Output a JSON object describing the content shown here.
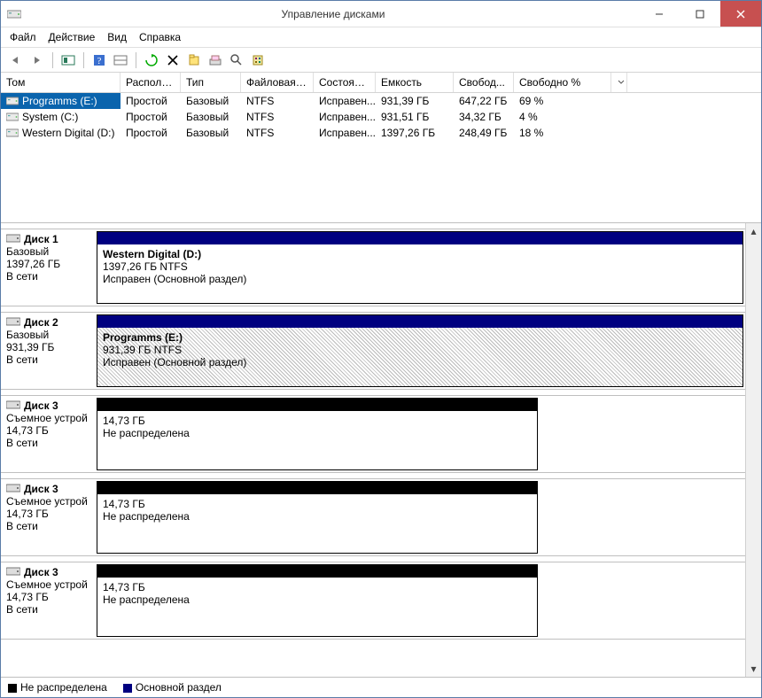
{
  "window": {
    "title": "Управление дисками"
  },
  "menu": {
    "file": "Файл",
    "action": "Действие",
    "view": "Вид",
    "help": "Справка"
  },
  "columns": {
    "c0": "Том",
    "c1": "Располо...",
    "c2": "Тип",
    "c3": "Файловая с...",
    "c4": "Состояние",
    "c5": "Емкость",
    "c6": "Свобод...",
    "c7": "Свободно %"
  },
  "volumes": [
    {
      "name": "Programms (E:)",
      "layout": "Простой",
      "type": "Базовый",
      "fs": "NTFS",
      "status": "Исправен...",
      "cap": "931,39 ГБ",
      "free": "647,22 ГБ",
      "pct": "69 %",
      "selected": true
    },
    {
      "name": "System (C:)",
      "layout": "Простой",
      "type": "Базовый",
      "fs": "NTFS",
      "status": "Исправен...",
      "cap": "931,51 ГБ",
      "free": "34,32 ГБ",
      "pct": "4 %",
      "selected": false
    },
    {
      "name": "Western Digital (D:)",
      "layout": "Простой",
      "type": "Базовый",
      "fs": "NTFS",
      "status": "Исправен...",
      "cap": "1397,26 ГБ",
      "free": "248,49 ГБ",
      "pct": "18 %",
      "selected": false
    }
  ],
  "disks": [
    {
      "title": "Диск 1",
      "type": "Базовый",
      "size": "1397,26 ГБ",
      "status": "В сети",
      "parts": [
        {
          "kind": "primary",
          "w": "full",
          "hatch": false,
          "l1": "Western Digital  (D:)",
          "l1b": true,
          "l2": "1397,26 ГБ NTFS",
          "l3": "Исправен (Основной раздел)"
        }
      ]
    },
    {
      "title": "Диск 2",
      "type": "Базовый",
      "size": "931,39 ГБ",
      "status": "В сети",
      "parts": [
        {
          "kind": "primary",
          "w": "full",
          "hatch": true,
          "l1": "Programms  (E:)",
          "l1b": true,
          "l2": "931,39 ГБ NTFS",
          "l3": "Исправен (Основной раздел)"
        }
      ]
    },
    {
      "title": "Диск 3",
      "type": "Съемное устрой",
      "size": "14,73 ГБ",
      "status": "В сети",
      "parts": [
        {
          "kind": "unalloc",
          "w": "mid",
          "hatch": false,
          "l1": "",
          "l1b": false,
          "l2": "14,73 ГБ",
          "l3": "Не распределена"
        }
      ]
    },
    {
      "title": "Диск 3",
      "type": "Съемное устрой",
      "size": "14,73 ГБ",
      "status": "В сети",
      "parts": [
        {
          "kind": "unalloc",
          "w": "mid",
          "hatch": false,
          "l1": "",
          "l1b": false,
          "l2": "14,73 ГБ",
          "l3": "Не распределена"
        }
      ]
    },
    {
      "title": "Диск 3",
      "type": "Съемное устрой",
      "size": "14,73 ГБ",
      "status": "В сети",
      "parts": [
        {
          "kind": "unalloc",
          "w": "mid",
          "hatch": false,
          "l1": "",
          "l1b": false,
          "l2": "14,73 ГБ",
          "l3": "Не распределена"
        }
      ]
    }
  ],
  "legend": {
    "unalloc": "Не распределена",
    "primary": "Основной раздел"
  }
}
